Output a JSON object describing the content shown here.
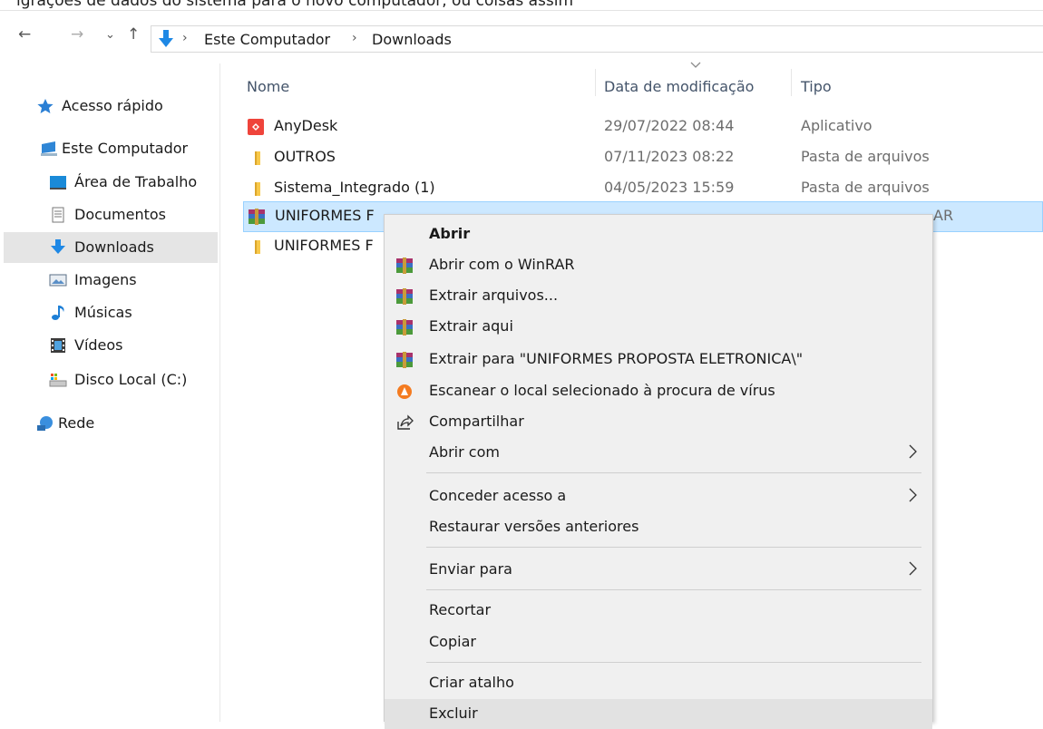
{
  "top_strip_text": "igrações de dados do sistema para o novo computador, ou coisas assim",
  "nav": {
    "back_glyph": "←",
    "forward_glyph": "→",
    "recent_glyph": "⌄",
    "up_glyph": "↑"
  },
  "address_bar": {
    "separator": "›",
    "crumbs": [
      "Este Computador",
      "Downloads"
    ]
  },
  "sidebar": {
    "items": [
      {
        "label": "Acesso rápido",
        "icon": "star-icon"
      },
      {
        "label": "Este Computador",
        "icon": "computer-icon"
      },
      {
        "label": "Área de Trabalho",
        "icon": "desktop-icon"
      },
      {
        "label": "Documentos",
        "icon": "document-icon"
      },
      {
        "label": "Downloads",
        "icon": "download-icon",
        "active": true
      },
      {
        "label": "Imagens",
        "icon": "image-icon"
      },
      {
        "label": "Músicas",
        "icon": "music-icon"
      },
      {
        "label": "Vídeos",
        "icon": "video-icon"
      },
      {
        "label": "Disco Local (C:)",
        "icon": "drive-icon"
      },
      {
        "label": "Rede",
        "icon": "network-icon"
      }
    ]
  },
  "columns": {
    "name": "Nome",
    "date": "Data de modificação",
    "type": "Tipo"
  },
  "files": [
    {
      "name": "AnyDesk",
      "date": "29/07/2022 08:44",
      "type": "Aplicativo",
      "icon": "anydesk-icon"
    },
    {
      "name": "OUTROS",
      "date": "07/11/2023 08:22",
      "type": "Pasta de arquivos",
      "icon": "folder-icon"
    },
    {
      "name": "Sistema_Integrado (1)",
      "date": "04/05/2023 15:59",
      "type": "Pasta de arquivos",
      "icon": "folder-icon"
    },
    {
      "name": "UNIFORMES F",
      "date": "",
      "type": "AR",
      "icon": "winrar-icon",
      "selected": true
    },
    {
      "name": "UNIFORMES F",
      "date": "",
      "type": "",
      "icon": "folder-icon"
    }
  ],
  "context_menu": {
    "items": [
      {
        "label": "Abrir",
        "bold": true
      },
      {
        "label": "Abrir com o WinRAR",
        "icon": "winrar-icon"
      },
      {
        "label": "Extrair arquivos...",
        "icon": "winrar-icon"
      },
      {
        "label": "Extrair aqui",
        "icon": "winrar-icon"
      },
      {
        "label": "Extrair para \"UNIFORMES PROPOSTA ELETRONICA\\\"",
        "icon": "winrar-icon"
      },
      {
        "label": "Escanear o local selecionado à procura de vírus",
        "icon": "antivirus-icon"
      },
      {
        "label": "Compartilhar",
        "icon": "share-icon"
      },
      {
        "label": "Abrir com",
        "submenu": true
      },
      {
        "label": "Conceder acesso a",
        "submenu": true
      },
      {
        "label": "Restaurar versões anteriores"
      },
      {
        "label": "Enviar para",
        "submenu": true
      },
      {
        "label": "Recortar"
      },
      {
        "label": "Copiar"
      },
      {
        "label": "Criar atalho"
      },
      {
        "label": "Excluir"
      }
    ]
  },
  "colors": {
    "selection_bg": "#cce8ff",
    "selection_border": "#99d1ff",
    "menu_bg": "#f0f0f0",
    "folder": "#f8c94b",
    "anydesk": "#ef443b",
    "download_blue": "#1e88e5"
  }
}
